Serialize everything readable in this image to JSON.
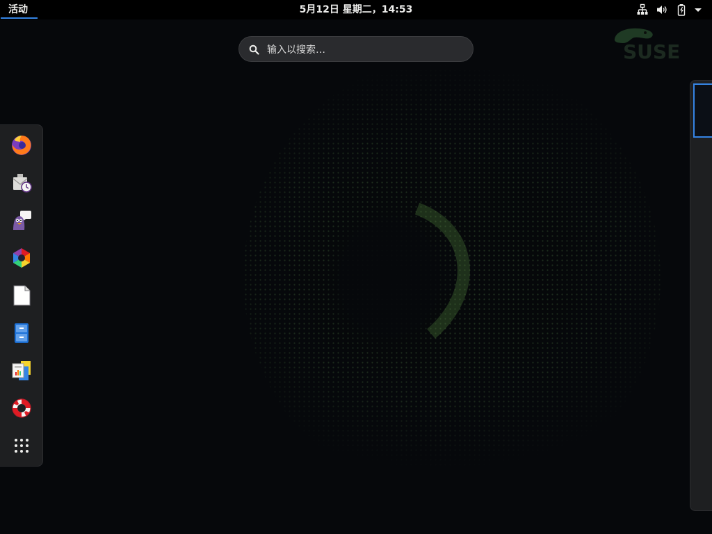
{
  "topbar": {
    "activities_label": "活动",
    "clock": "5月12日 星期二，14:53",
    "tray": [
      {
        "name": "network-wired-icon"
      },
      {
        "name": "volume-icon"
      },
      {
        "name": "battery-charging-icon"
      },
      {
        "name": "system-menu-arrow-icon"
      }
    ]
  },
  "search": {
    "placeholder": "输入以搜索…",
    "value": ""
  },
  "dash": {
    "items": [
      {
        "name": "firefox-icon"
      },
      {
        "name": "evolution-mail-icon"
      },
      {
        "name": "pidgin-chat-icon"
      },
      {
        "name": "photos-icon"
      },
      {
        "name": "document-icon"
      },
      {
        "name": "file-cabinet-icon"
      },
      {
        "name": "office-suite-icon"
      },
      {
        "name": "help-lifebuoy-icon"
      },
      {
        "name": "show-applications-icon"
      }
    ]
  },
  "workspace": {
    "count": 1
  },
  "branding": {
    "wallpaper_logo": "SUSE",
    "accent": "#3584e4"
  }
}
